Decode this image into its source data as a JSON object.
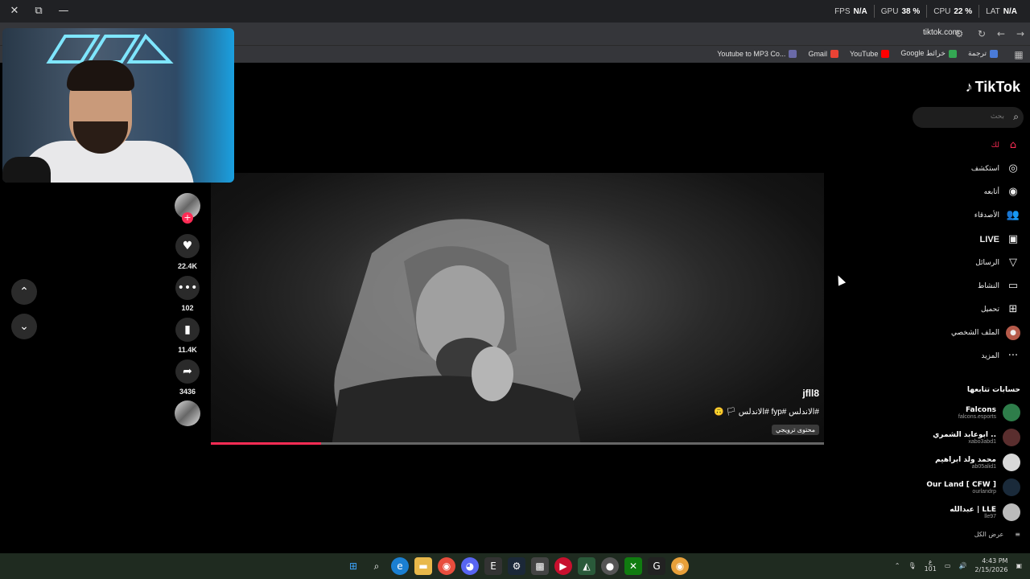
{
  "perf": [
    {
      "label": "FPS",
      "value": "N/A"
    },
    {
      "label": "GPU",
      "value": "38 %"
    },
    {
      "label": "CPU",
      "value": "22 %"
    },
    {
      "label": "LAT",
      "value": "N/A"
    }
  ],
  "browser": {
    "url": "tiktok.com",
    "bookmarks": [
      "ترجمة",
      "Google خرائط",
      "YouTube",
      "Gmail",
      "Youtube to MP3 Co..."
    ]
  },
  "video": {
    "author": "jfll8",
    "caption": "#الاندلس #fyp #الاندلس 🏳 🙃",
    "badge": "محتوى ترويجي",
    "progress": 0.18
  },
  "actions": {
    "likes": "22.4K",
    "comments": "102",
    "saves": "11.4K",
    "shares": "3436"
  },
  "sidebar": {
    "logo": "TikTok",
    "search_placeholder": "بحث",
    "nav": [
      {
        "label": "لك",
        "icon": "home-icon",
        "active": true
      },
      {
        "label": "استكشف",
        "icon": "compass-icon"
      },
      {
        "label": "أتابعه",
        "icon": "following-icon"
      },
      {
        "label": "الأصدقاء",
        "icon": "friends-icon"
      },
      {
        "label": "LIVE",
        "icon": "live-icon"
      },
      {
        "label": "الرسائل",
        "icon": "messages-icon"
      },
      {
        "label": "النشاط",
        "icon": "activity-icon"
      },
      {
        "label": "تحميل",
        "icon": "upload-icon"
      },
      {
        "label": "الملف الشخصي",
        "icon": "profile-icon"
      },
      {
        "label": "المزيد",
        "icon": "more-icon"
      }
    ],
    "following_title": "حسابات تتابعها",
    "accounts": [
      {
        "name": "Falcons",
        "handle": "falcons.esports",
        "color": "#2e7d4a"
      },
      {
        "name": "ابوعابد الشمري ..",
        "handle": "xabo3abd1",
        "color": "#5a2e2e"
      },
      {
        "name": "محمد ولد ابراهيم",
        "handle": "ab05alid1",
        "color": "#d8d8d8"
      },
      {
        "name": "Our Land [ CFW ]",
        "handle": "ourlandrp",
        "color": "#1a2a3a"
      },
      {
        "name": "عبدالله | LLE",
        "handle": "lle97",
        "color": "#bbbbbb"
      }
    ],
    "see_all": "عرض الكل"
  },
  "taskbar": {
    "time": "4:43 PM",
    "date": "2/15/2026",
    "lang": "ع",
    "lang_sub": "101"
  }
}
